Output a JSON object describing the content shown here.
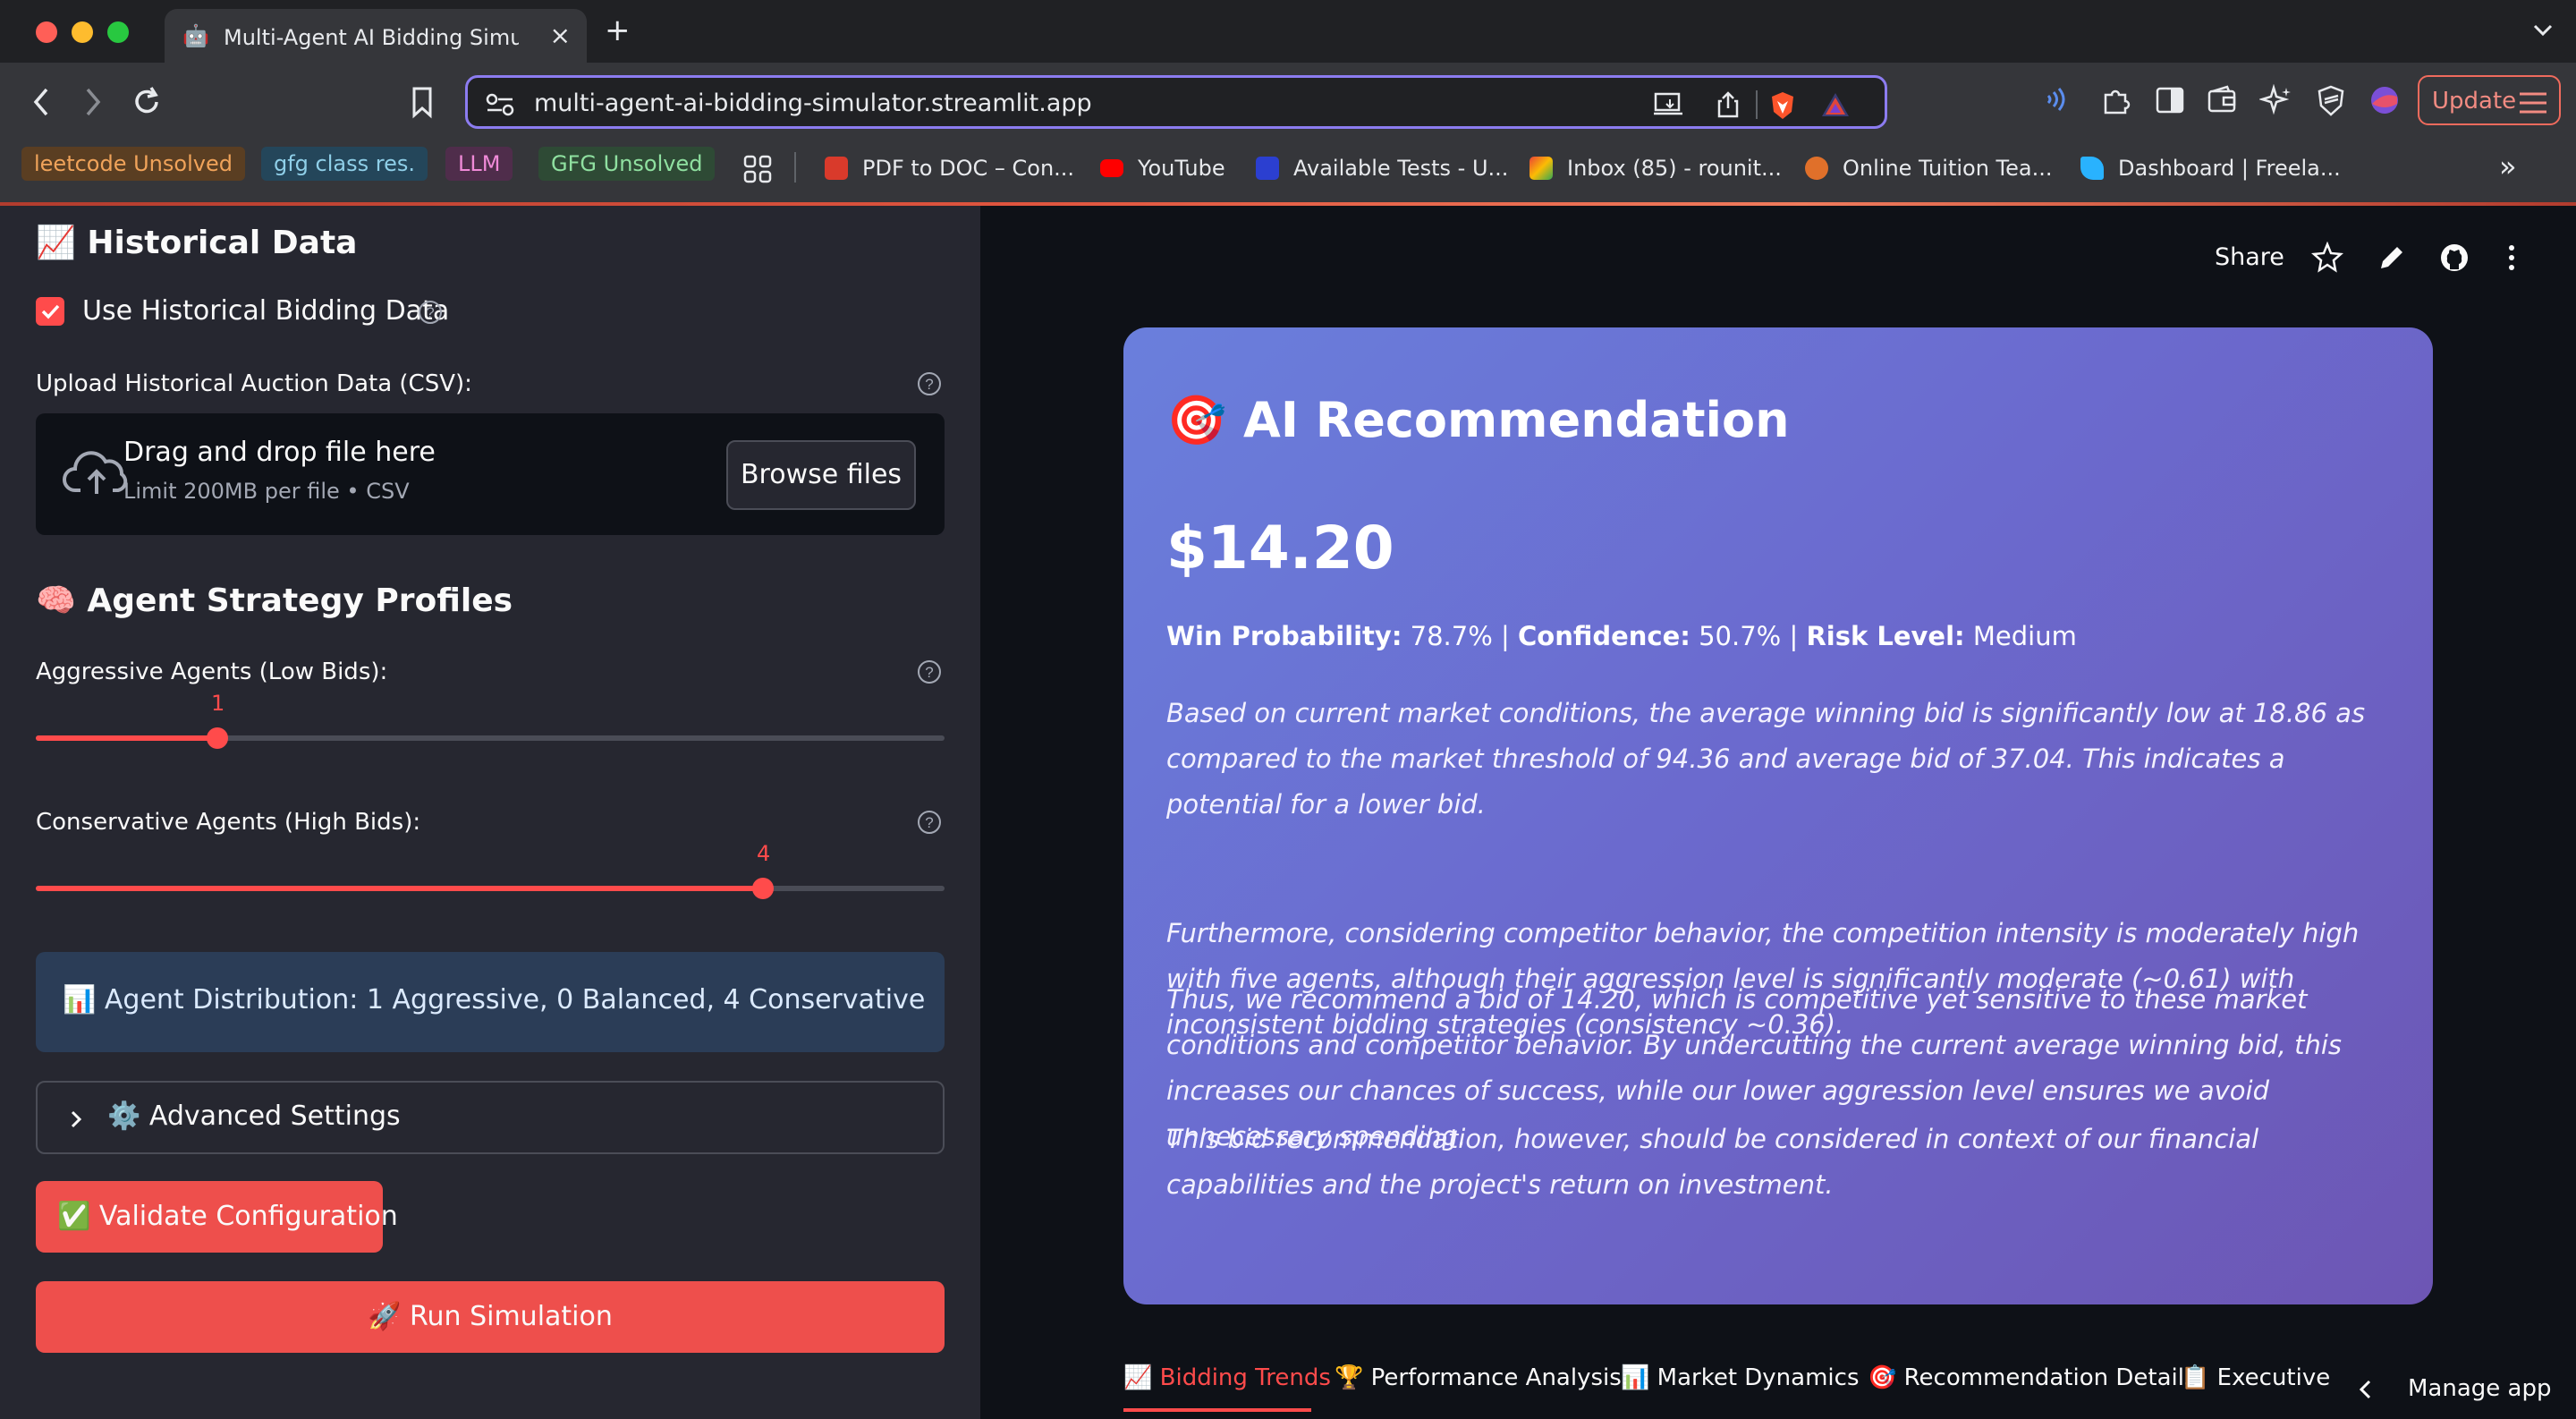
{
  "browser": {
    "tab_icon": "🤖",
    "tab_title": "Multi-Agent AI Bidding Simula",
    "url": "multi-agent-ai-bidding-simulator.streamlit.app",
    "update_label": "Update",
    "bookmarks": [
      "leetcode Unsolved",
      "gfg class res.",
      "LLM",
      "GFG Unsolved",
      "PDF to DOC – Con...",
      "YouTube",
      "Available Tests - U...",
      "Inbox (85) - rounit...",
      "Online Tuition Tea...",
      "Dashboard | Freela..."
    ],
    "colors": {
      "chip1": "#8a5a2a",
      "chip2": "#2f5f77",
      "chip3": "#6b3a63",
      "chip4": "#3a6a44"
    }
  },
  "sidebar": {
    "historical_heading": "📈 Historical Data",
    "use_historical_label": "Use Historical Bidding Data",
    "use_historical_checked": true,
    "upload_label": "Upload Historical Auction Data (CSV):",
    "drop_title": "Drag and drop file here",
    "drop_subtitle": "Limit 200MB per file • CSV",
    "browse_label": "Browse files",
    "agent_heading": "🧠 Agent Strategy Profiles",
    "aggressive_label": "Aggressive Agents (Low Bids):",
    "aggressive_value": "1",
    "aggressive_fraction": 0.2,
    "conservative_label": "Conservative Agents (High Bids):",
    "conservative_value": "4",
    "conservative_fraction": 0.8,
    "distribution_text": "📊 Agent Distribution: 1 Aggressive, 0 Balanced, 4 Conservative",
    "advanced_label": "⚙️ Advanced Settings",
    "validate_label": "✅ Validate Configuration",
    "run_label": "🚀 Run Simulation"
  },
  "main": {
    "share_label": "Share",
    "card": {
      "title": "🎯 AI Recommendation",
      "price": "$14.20",
      "win_prob_label": "Win Probability:",
      "win_prob_value": "78.7%",
      "confidence_label": "Confidence:",
      "confidence_value": "50.7%",
      "risk_label": "Risk Level:",
      "risk_value": "Medium",
      "paragraphs": [
        "Based on current market conditions, the average winning bid is significantly low at 18.86 as compared to the market threshold of 94.36 and average bid of 37.04. This indicates a potential for a lower bid.",
        "Furthermore, considering competitor behavior, the competition intensity is moderately high with five agents, although their aggression level is significantly moderate (~0.61) with inconsistent bidding strategies (consistency ~0.36).",
        "Thus, we recommend a bid of 14.20, which is competitive yet sensitive to these market conditions and competitor behavior. By undercutting the current average winning bid, this increases our chances of success, while our lower aggression level ensures we avoid unnecessary spending.",
        "This bid recommendation, however, should be considered in context of our financial capabilities and the project's return on investment."
      ]
    },
    "tabs": [
      "📈 Bidding Trends",
      "🏆 Performance Analysis",
      "📊 Market Dynamics",
      "🎯 Recommendation Details",
      "📋 Executive"
    ],
    "manage_app_label": "Manage app"
  }
}
